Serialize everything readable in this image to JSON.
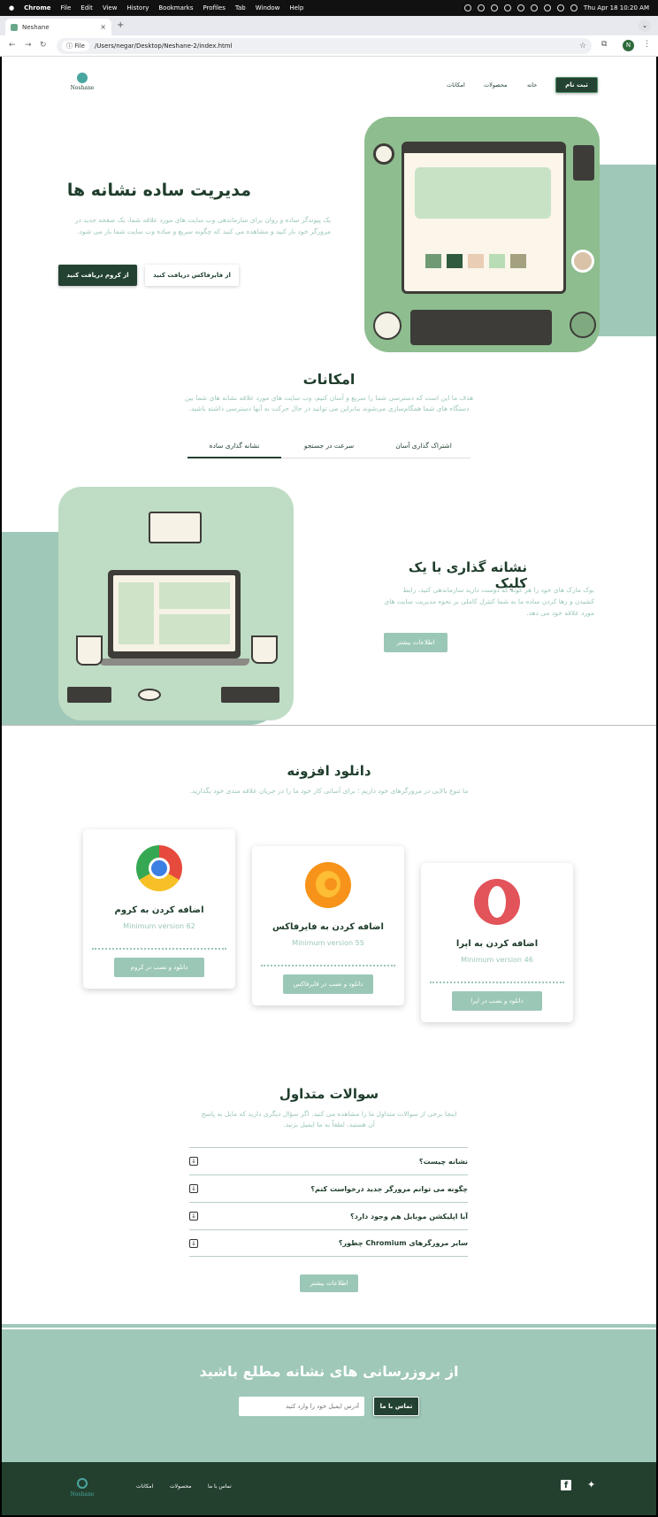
{
  "menubar": {
    "apple": "",
    "app": "Chrome",
    "items": [
      "File",
      "Edit",
      "View",
      "History",
      "Bookmarks",
      "Profiles",
      "Tab",
      "Window",
      "Help"
    ],
    "datetime": "Thu Apr 18  10:20 AM"
  },
  "browser": {
    "tab_title": "Neshane",
    "tab_close": "×",
    "new_tab": "+",
    "scheme_label": "File",
    "url": "/Users/negar/Desktop/Neshane-2/index.html",
    "profile_initial": "N"
  },
  "header": {
    "logo_text": "Neshane",
    "nav": [
      "خانه",
      "محصولات",
      "امکانات"
    ],
    "signup": "ثبت نام"
  },
  "hero": {
    "title": "مدیریت ساده نشانه ها",
    "description": "یک پیوندگر ساده و روان برای سازماندهی وب سایت های مورد علاقه شما، یک صفحه جدید در مرورگر خود باز کنید و مشاهده می کنید که چگونه سریع و ساده وب سایت شما باز می شود.",
    "chrome_button": "از کروم دریافت کنید",
    "firefox_button": "از فایرفاکس دریافت کنید"
  },
  "features": {
    "title": "امکانات",
    "description": "هدف ما این است که دسترسی شما را سریع و آسان کنیم، وب سایت های مورد علاقه نشانه های شما بین دستگاه های شما همگام‌سازی می‌شوند بنابراین می توانید در حال حرکت به آنها دسترسی داشته باشید.",
    "tabs": [
      "اشتراک گذاری آسان",
      "سرعت در جستجو",
      "نشانه گذاری ساده"
    ],
    "active_tab": 2,
    "panel_title": "نشانه گذاری با یک کلیک",
    "panel_text": "بوک مارک های خود را هر گونه که دوست دارید سازماندهی کنید، رابط کشیدن و رها کردن ساده ما به شما کنترل کاملی بر نحوه مدیریت سایت های مورد علاقه خود می دهد.",
    "more_button": "اطلاعات بیشتر"
  },
  "download": {
    "title": "دانلود افزونه",
    "subtitle": "ما تنوع بالایی در مرورگرهای خود داریم ؛ برای آسانی کار خود ما را در جریان علاقه مندی خود بگذارید.",
    "cards": [
      {
        "title": "اضافه کردن به کروم",
        "version": "Minimum version 62",
        "button": "دانلود و نصب در کروم",
        "icon": "chrome-logo-icon"
      },
      {
        "title": "اضافه کردن به فایرفاکس",
        "version": "Minimum version 55",
        "button": "دانلود و نصب در فایرفاکس",
        "icon": "firefox-logo-icon"
      },
      {
        "title": "اضافه کردن به اپرا",
        "version": "Minimum version 46",
        "button": "دانلود و نصب در اپرا",
        "icon": "opera-logo-icon"
      }
    ]
  },
  "faq": {
    "title": "سوالات متداول",
    "description": "اینجا برخی از سوالات متداول ما را مشاهده می کنید. اگر سؤال دیگری دارید که مایل به پاسخ آن هستید، لطفاً به ما ایمیل بزنید.",
    "questions": [
      "نشانه چیست؟",
      "چگونه می توانم مرورگر جدید درخواست کنم؟",
      "آیا اپلیکشن موبایل هم وجود دارد؟",
      "سایر مرورگرهای Chromium چطور؟"
    ],
    "more_button": "اطلاعات بیشتر"
  },
  "newsletter": {
    "title": "از بروزرسانی های نشانه مطلع باشید",
    "email_placeholder": "آدرس ایمیل خود را وارد کنید",
    "button": "تماس با ما"
  },
  "footer": {
    "logo_text": "Neshane",
    "links": [
      "امکانات",
      "محصولات",
      "تماس با ما"
    ],
    "social": [
      "facebook-icon",
      "twitter-icon"
    ]
  },
  "colors": {
    "brand_dark": "#234231",
    "mint": "#9bc7b6",
    "footer_bg": "#23402f"
  }
}
